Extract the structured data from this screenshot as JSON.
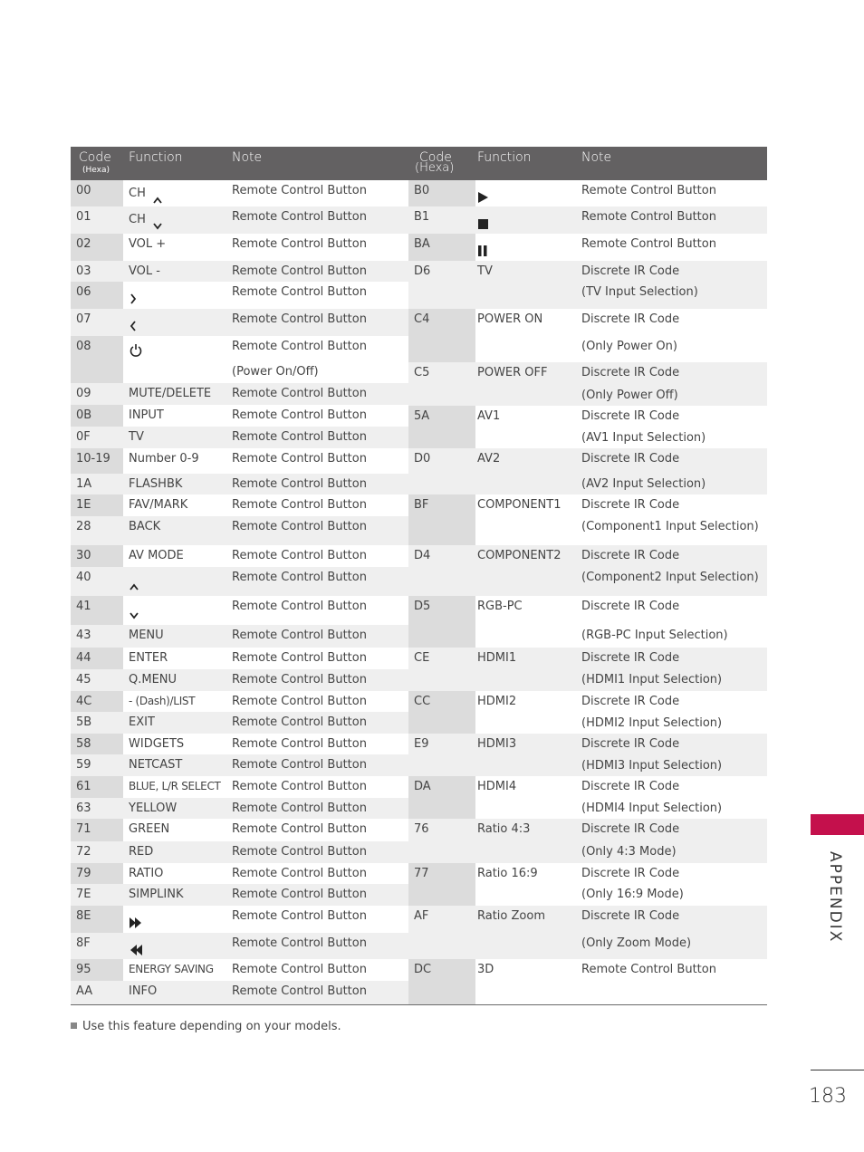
{
  "table": {
    "header": {
      "left": {
        "code": "Code",
        "code_sub": "(Hexa)",
        "function": "Function",
        "note": "Note"
      },
      "right": {
        "code": "Code",
        "code_sub": "(Hexa)",
        "function": "Function",
        "note": "Note"
      }
    },
    "left_rows": [
      {
        "code": "00",
        "function": "CH",
        "icon": "chevron-up",
        "note": "Remote Control Button"
      },
      {
        "code": "01",
        "function": "CH",
        "icon": "chevron-down",
        "note": "Remote Control Button"
      },
      {
        "code": "02",
        "function": "VOL +",
        "note": "Remote Control Button"
      },
      {
        "code": "03",
        "function": "VOL -",
        "note": "Remote Control Button"
      },
      {
        "code": "06",
        "function": "",
        "icon": "chevron-right",
        "note": "Remote Control Button"
      },
      {
        "code": "07",
        "function": "",
        "icon": "chevron-left",
        "note": "Remote Control Button"
      },
      {
        "code": "08",
        "function": "",
        "icon": "power",
        "note": "Remote Control Button",
        "note2": "(Power On/Off)"
      },
      {
        "code": "09",
        "function": "MUTE/DELETE",
        "note": "Remote Control Button"
      },
      {
        "code": "0B",
        "function": "INPUT",
        "note": "Remote Control Button"
      },
      {
        "code": "0F",
        "function": "TV",
        "note": "Remote Control Button"
      },
      {
        "code": "10-19",
        "function": "Number 0-9",
        "note": "Remote Control Button"
      },
      {
        "code": "1A",
        "function": "FLASHBK",
        "note": "Remote Control Button"
      },
      {
        "code": "1E",
        "function": "FAV/MARK",
        "note": "Remote Control Button"
      },
      {
        "code": "28",
        "function": "BACK",
        "note": "Remote Control Button"
      },
      {
        "code": "30",
        "function": "AV MODE",
        "note": "Remote Control Button"
      },
      {
        "code": "40",
        "function": "",
        "icon": "chevron-up",
        "note": "Remote Control Button"
      },
      {
        "code": "41",
        "function": "",
        "icon": "chevron-down",
        "note": "Remote Control Button"
      },
      {
        "code": "43",
        "function": "MENU",
        "note": "Remote Control Button"
      },
      {
        "code": "44",
        "function": "ENTER",
        "note": "Remote Control Button"
      },
      {
        "code": "45",
        "function": "Q.MENU",
        "note": "Remote Control Button"
      },
      {
        "code": "4C",
        "function": "- (Dash)/LIST",
        "note": "Remote Control Button"
      },
      {
        "code": "5B",
        "function": "EXIT",
        "note": "Remote Control Button"
      },
      {
        "code": "58",
        "function": "WIDGETS",
        "note": "Remote Control Button"
      },
      {
        "code": "59",
        "function": "NETCAST",
        "note": "Remote Control Button"
      },
      {
        "code": "61",
        "function": "BLUE, L/R SELECT",
        "note": "Remote Control Button"
      },
      {
        "code": "63",
        "function": "YELLOW",
        "note": "Remote Control Button"
      },
      {
        "code": "71",
        "function": "GREEN",
        "note": "Remote Control Button"
      },
      {
        "code": "72",
        "function": "RED",
        "note": "Remote Control Button"
      },
      {
        "code": "79",
        "function": "RATIO",
        "note": "Remote Control Button"
      },
      {
        "code": "7E",
        "function": "SIMPLINK",
        "note": "Remote Control Button"
      },
      {
        "code": "8E",
        "function": "",
        "icon": "fast-forward",
        "note": "Remote Control Button"
      },
      {
        "code": "8F",
        "function": "",
        "icon": "rewind",
        "note": "Remote Control Button"
      },
      {
        "code": "95",
        "function": "ENERGY SAVING",
        "note": "Remote Control Button"
      },
      {
        "code": "AA",
        "function": "INFO",
        "note": "Remote Control Button"
      }
    ],
    "right_rows": [
      {
        "code": "B0",
        "function": "",
        "icon": "play",
        "note": "Remote Control Button"
      },
      {
        "code": "B1",
        "function": "",
        "icon": "stop",
        "note": "Remote Control Button"
      },
      {
        "code": "BA",
        "function": "",
        "icon": "pause",
        "note": "Remote Control Button"
      },
      {
        "code": "D6",
        "function": "TV",
        "note": "Discrete IR Code",
        "note2": "(TV Input Selection)"
      },
      {
        "code": "C4",
        "function": "POWER ON",
        "note": "Discrete IR Code",
        "note2": "(Only Power On)"
      },
      {
        "code": "C5",
        "function": "POWER OFF",
        "note": "Discrete IR Code",
        "note2": "(Only Power Off)"
      },
      {
        "code": "5A",
        "function": "AV1",
        "note": "Discrete IR Code",
        "note2": "(AV1 Input Selection)"
      },
      {
        "code": "D0",
        "function": "AV2",
        "note": "Discrete IR Code",
        "note2": "(AV2 Input Selection)"
      },
      {
        "code": "BF",
        "function": "COMPONENT1",
        "note": "Discrete IR Code",
        "note2": "(Component1 Input Selection)"
      },
      {
        "code": "D4",
        "function": "COMPONENT2",
        "note": "Discrete IR Code",
        "note2": "(Component2 Input Selection)"
      },
      {
        "code": "D5",
        "function": "RGB-PC",
        "note": "Discrete IR Code",
        "note2": "(RGB-PC Input Selection)"
      },
      {
        "code": "CE",
        "function": "HDMI1",
        "note": "Discrete IR Code",
        "note2": "(HDMI1 Input Selection)"
      },
      {
        "code": "CC",
        "function": "HDMI2",
        "note": "Discrete IR Code",
        "note2": "(HDMI2 Input Selection)"
      },
      {
        "code": "E9",
        "function": "HDMI3",
        "note": "Discrete IR Code",
        "note2": "(HDMI3 Input Selection)"
      },
      {
        "code": "DA",
        "function": "HDMI4",
        "note": "Discrete IR Code",
        "note2": "(HDMI4 Input Selection)"
      },
      {
        "code": "76",
        "function": "Ratio 4:3",
        "note": "Discrete IR Code",
        "note2": "(Only 4:3 Mode)"
      },
      {
        "code": "77",
        "function": "Ratio 16:9",
        "note": "Discrete IR Code",
        "note2": "(Only 16:9 Mode)"
      },
      {
        "code": "AF",
        "function": "Ratio Zoom",
        "note": "Discrete IR Code",
        "note2": "(Only Zoom Mode)"
      },
      {
        "code": "DC",
        "function": "3D",
        "note": "Remote Control Button"
      }
    ]
  },
  "footnote": "Use this feature depending on your models.",
  "section_label": "APPENDIX",
  "page_number": "183",
  "colors": {
    "header_bg": "#636162",
    "accent": "#c4104c",
    "row_grey": "#efefef",
    "code_col_dark": "#dcdcdc"
  }
}
